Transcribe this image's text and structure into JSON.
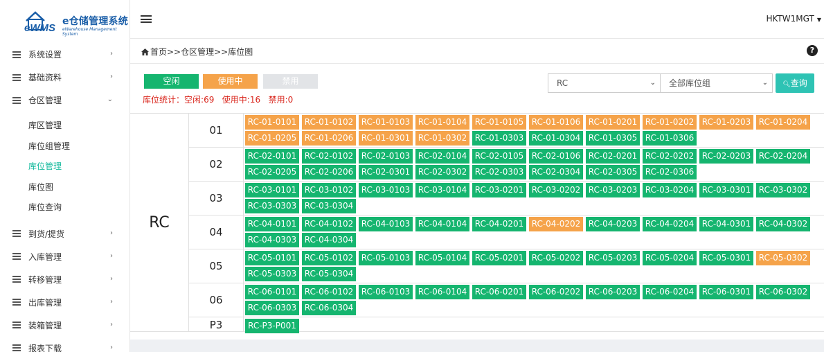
{
  "app": {
    "logo_text": "eWMS",
    "title": "e仓储管理系统",
    "subtitle": "eWarehouse Management System"
  },
  "colors": {
    "free": "#15b56f",
    "used": "#f5a34a",
    "disabled": "#e2e4e7",
    "accent": "#13b99c",
    "stats_red": "#d9241b",
    "search_btn": "#2ec3b4"
  },
  "sidebar": {
    "items": [
      {
        "label": "系统设置",
        "icon": "list-icon"
      },
      {
        "label": "基础资料",
        "icon": "list-icon"
      },
      {
        "label": "仓区管理",
        "icon": "list-icon",
        "expanded": true
      },
      {
        "label": "到货/提货",
        "icon": "list-icon"
      },
      {
        "label": "入库管理",
        "icon": "list-icon"
      },
      {
        "label": "转移管理",
        "icon": "list-icon"
      },
      {
        "label": "出库管理",
        "icon": "list-icon"
      },
      {
        "label": "装箱管理",
        "icon": "list-icon"
      },
      {
        "label": "报表下载",
        "icon": "list-icon"
      }
    ],
    "submenu": [
      {
        "label": "库区管理"
      },
      {
        "label": "库位组管理"
      },
      {
        "label": "库位管理",
        "active": true
      },
      {
        "label": "库位图"
      },
      {
        "label": "库位查询"
      }
    ]
  },
  "header": {
    "user": "HKTW1MGT"
  },
  "breadcrumb": "首页>>仓区管理>>库位图",
  "legend": {
    "free": "空闲",
    "used": "使用中",
    "disabled": "禁用"
  },
  "stats": {
    "label": "库位统计：",
    "free_label": "空闲:",
    "free": "69",
    "used_label": "使用中:",
    "used": "16",
    "disabled_label": "禁用:",
    "disabled": "0"
  },
  "filters": {
    "area": "RC",
    "group": "全部库位组",
    "search_label": "查询"
  },
  "grid": {
    "area": "RC",
    "racks": [
      {
        "label": "01",
        "cells": [
          {
            "code": "RC-01-0101",
            "status": "used"
          },
          {
            "code": "RC-01-0102",
            "status": "used"
          },
          {
            "code": "RC-01-0103",
            "status": "used"
          },
          {
            "code": "RC-01-0104",
            "status": "used"
          },
          {
            "code": "RC-01-0105",
            "status": "used"
          },
          {
            "code": "RC-01-0106",
            "status": "used"
          },
          {
            "code": "RC-01-0201",
            "status": "used"
          },
          {
            "code": "RC-01-0202",
            "status": "used"
          },
          {
            "code": "RC-01-0203",
            "status": "used"
          },
          {
            "code": "RC-01-0204",
            "status": "used"
          },
          {
            "code": "RC-01-0205",
            "status": "used"
          },
          {
            "code": "RC-01-0206",
            "status": "used"
          },
          {
            "code": "RC-01-0301",
            "status": "used"
          },
          {
            "code": "RC-01-0302",
            "status": "used"
          },
          {
            "code": "RC-01-0303",
            "status": "free"
          },
          {
            "code": "RC-01-0304",
            "status": "free"
          },
          {
            "code": "RC-01-0305",
            "status": "free"
          },
          {
            "code": "RC-01-0306",
            "status": "free"
          }
        ]
      },
      {
        "label": "02",
        "cells": [
          {
            "code": "RC-02-0101",
            "status": "free"
          },
          {
            "code": "RC-02-0102",
            "status": "free"
          },
          {
            "code": "RC-02-0103",
            "status": "free"
          },
          {
            "code": "RC-02-0104",
            "status": "free"
          },
          {
            "code": "RC-02-0105",
            "status": "free"
          },
          {
            "code": "RC-02-0106",
            "status": "free"
          },
          {
            "code": "RC-02-0201",
            "status": "free"
          },
          {
            "code": "RC-02-0202",
            "status": "free"
          },
          {
            "code": "RC-02-0203",
            "status": "free"
          },
          {
            "code": "RC-02-0204",
            "status": "free"
          },
          {
            "code": "RC-02-0205",
            "status": "free"
          },
          {
            "code": "RC-02-0206",
            "status": "free"
          },
          {
            "code": "RC-02-0301",
            "status": "free"
          },
          {
            "code": "RC-02-0302",
            "status": "free"
          },
          {
            "code": "RC-02-0303",
            "status": "free"
          },
          {
            "code": "RC-02-0304",
            "status": "free"
          },
          {
            "code": "RC-02-0305",
            "status": "free"
          },
          {
            "code": "RC-02-0306",
            "status": "free"
          }
        ]
      },
      {
        "label": "03",
        "cells": [
          {
            "code": "RC-03-0101",
            "status": "free"
          },
          {
            "code": "RC-03-0102",
            "status": "free"
          },
          {
            "code": "RC-03-0103",
            "status": "free"
          },
          {
            "code": "RC-03-0104",
            "status": "free"
          },
          {
            "code": "RC-03-0201",
            "status": "free"
          },
          {
            "code": "RC-03-0202",
            "status": "free"
          },
          {
            "code": "RC-03-0203",
            "status": "free"
          },
          {
            "code": "RC-03-0204",
            "status": "free"
          },
          {
            "code": "RC-03-0301",
            "status": "free"
          },
          {
            "code": "RC-03-0302",
            "status": "free"
          },
          {
            "code": "RC-03-0303",
            "status": "free"
          },
          {
            "code": "RC-03-0304",
            "status": "free"
          }
        ]
      },
      {
        "label": "04",
        "cells": [
          {
            "code": "RC-04-0101",
            "status": "free"
          },
          {
            "code": "RC-04-0102",
            "status": "free"
          },
          {
            "code": "RC-04-0103",
            "status": "free"
          },
          {
            "code": "RC-04-0104",
            "status": "free"
          },
          {
            "code": "RC-04-0201",
            "status": "free"
          },
          {
            "code": "RC-04-0202",
            "status": "used"
          },
          {
            "code": "RC-04-0203",
            "status": "free"
          },
          {
            "code": "RC-04-0204",
            "status": "free"
          },
          {
            "code": "RC-04-0301",
            "status": "free"
          },
          {
            "code": "RC-04-0302",
            "status": "free"
          },
          {
            "code": "RC-04-0303",
            "status": "free"
          },
          {
            "code": "RC-04-0304",
            "status": "free"
          }
        ]
      },
      {
        "label": "05",
        "cells": [
          {
            "code": "RC-05-0101",
            "status": "free"
          },
          {
            "code": "RC-05-0102",
            "status": "free"
          },
          {
            "code": "RC-05-0103",
            "status": "free"
          },
          {
            "code": "RC-05-0104",
            "status": "free"
          },
          {
            "code": "RC-05-0201",
            "status": "free"
          },
          {
            "code": "RC-05-0202",
            "status": "free"
          },
          {
            "code": "RC-05-0203",
            "status": "free"
          },
          {
            "code": "RC-05-0204",
            "status": "free"
          },
          {
            "code": "RC-05-0301",
            "status": "free"
          },
          {
            "code": "RC-05-0302",
            "status": "used"
          },
          {
            "code": "RC-05-0303",
            "status": "free"
          },
          {
            "code": "RC-05-0304",
            "status": "free"
          }
        ]
      },
      {
        "label": "06",
        "cells": [
          {
            "code": "RC-06-0101",
            "status": "free"
          },
          {
            "code": "RC-06-0102",
            "status": "free"
          },
          {
            "code": "RC-06-0103",
            "status": "free"
          },
          {
            "code": "RC-06-0104",
            "status": "free"
          },
          {
            "code": "RC-06-0201",
            "status": "free"
          },
          {
            "code": "RC-06-0202",
            "status": "free"
          },
          {
            "code": "RC-06-0203",
            "status": "free"
          },
          {
            "code": "RC-06-0204",
            "status": "free"
          },
          {
            "code": "RC-06-0301",
            "status": "free"
          },
          {
            "code": "RC-06-0302",
            "status": "free"
          },
          {
            "code": "RC-06-0303",
            "status": "free"
          },
          {
            "code": "RC-06-0304",
            "status": "free"
          }
        ]
      },
      {
        "label": "P3",
        "cells": [
          {
            "code": "RC-P3-P001",
            "status": "free"
          }
        ]
      }
    ]
  }
}
